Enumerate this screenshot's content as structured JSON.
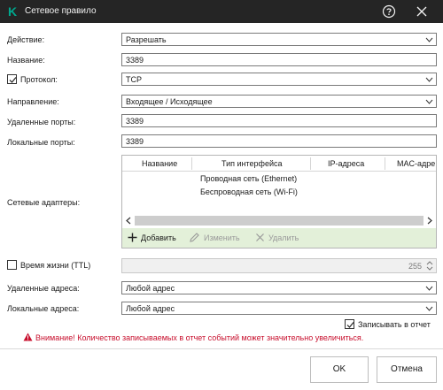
{
  "window": {
    "title": "Сетевое правило",
    "logo_letter": "K",
    "help_icon": "question-circle-icon",
    "close_icon": "close-icon"
  },
  "form": {
    "action": {
      "label": "Действие:",
      "value": "Разрешать"
    },
    "name": {
      "label": "Название:",
      "value": "3389"
    },
    "protocol": {
      "label": "Протокол:",
      "checked": true,
      "value": "TCP"
    },
    "direction": {
      "label": "Направление:",
      "value": "Входящее / Исходящее"
    },
    "remote_ports": {
      "label": "Удаленные порты:",
      "value": "3389"
    },
    "local_ports": {
      "label": "Локальные порты:",
      "value": "3389"
    },
    "adapters": {
      "label": "Сетевые адаптеры:",
      "columns": [
        "Название",
        "Тип интерфейса",
        "IP-адреса",
        "MAC-адре"
      ],
      "rows": [
        [
          "",
          "Проводная сеть (Ethernet)",
          "",
          ""
        ],
        [
          "",
          "Беспроводная сеть (Wi-Fi)",
          "",
          ""
        ]
      ],
      "toolbar": {
        "add": "Добавить",
        "edit": "Изменить",
        "delete": "Удалить"
      }
    },
    "ttl": {
      "label": "Время жизни (TTL)",
      "checked": false,
      "value": "255"
    },
    "remote_addresses": {
      "label": "Удаленные адреса:",
      "value": "Любой адрес"
    },
    "local_addresses": {
      "label": "Локальные адреса:",
      "value": "Любой адрес"
    },
    "log": {
      "label": "Записывать в отчет",
      "checked": true
    }
  },
  "warning": {
    "text": "Внимание! Количество записываемых в отчет событий может значительно увеличиться.",
    "color": "#c8102e"
  },
  "buttons": {
    "ok": "OK",
    "cancel": "Отмена"
  },
  "colors": {
    "titlebar": "#252525",
    "logo": "#00a88e",
    "toolbar_bg": "#e3f0d9"
  }
}
